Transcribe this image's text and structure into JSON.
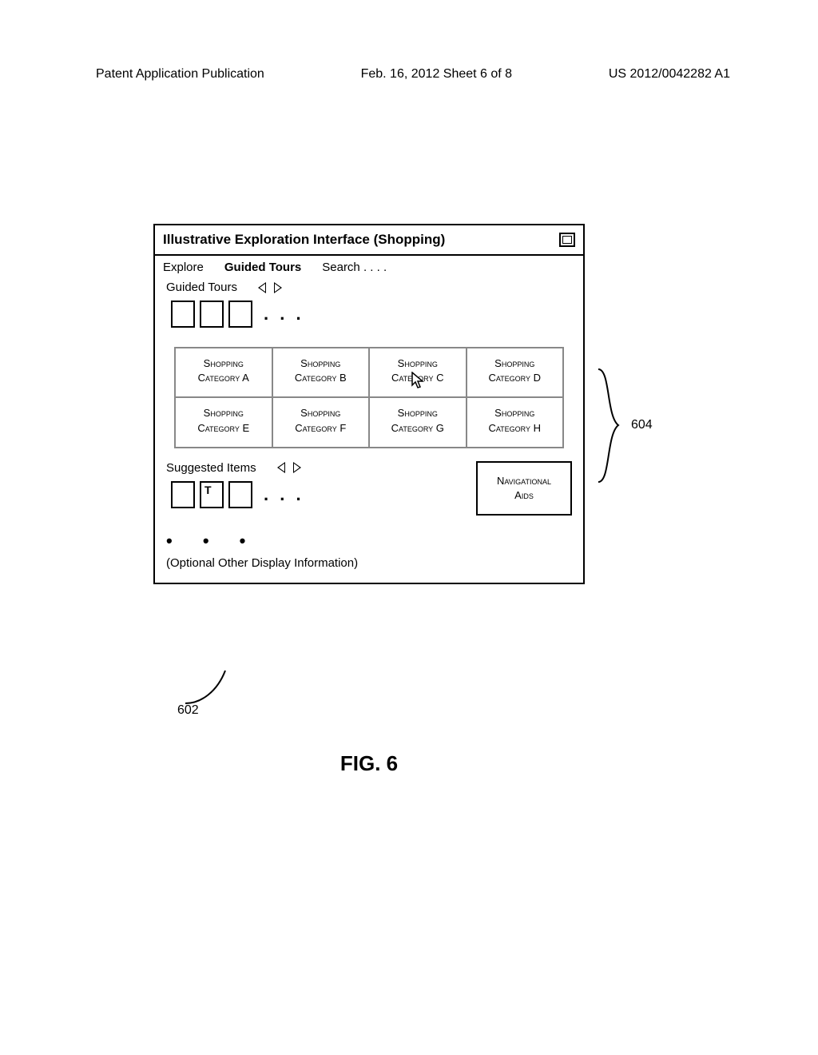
{
  "page_header": {
    "left": "Patent Application Publication",
    "center": "Feb. 16, 2012  Sheet 6 of 8",
    "right": "US 2012/0042282 A1"
  },
  "window": {
    "title": "Illustrative Exploration Interface (Shopping)",
    "tabs": {
      "explore": "Explore",
      "guided_tours": "Guided Tours",
      "search": "Search  . . . ."
    },
    "guided_tours_section": {
      "label": "Guided Tours",
      "ellipsis": ". . ."
    },
    "categories": [
      {
        "line1": "Shopping",
        "line2": "Category A",
        "cursor": false
      },
      {
        "line1": "Shopping",
        "line2": "Category B",
        "cursor": false
      },
      {
        "line1": "Shopping",
        "line2": "Category C",
        "cursor": true
      },
      {
        "line1": "Shopping",
        "line2": "Category D",
        "cursor": false
      },
      {
        "line1": "Shopping",
        "line2": "Category E",
        "cursor": false
      },
      {
        "line1": "Shopping",
        "line2": "Category F",
        "cursor": false
      },
      {
        "line1": "Shopping",
        "line2": "Category G",
        "cursor": false
      },
      {
        "line1": "Shopping",
        "line2": "Category H",
        "cursor": false
      }
    ],
    "suggested": {
      "label": "Suggested Items",
      "thumb_letter": "T",
      "ellipsis": ". . ."
    },
    "nav_aids": {
      "line1": "Navigational",
      "line2": "Aids"
    },
    "footer": {
      "bullets": "•  •  •",
      "text": "(Optional Other Display Information)"
    }
  },
  "labels": {
    "ref_604": "604",
    "ref_602": "602"
  },
  "caption": "FIG. 6"
}
